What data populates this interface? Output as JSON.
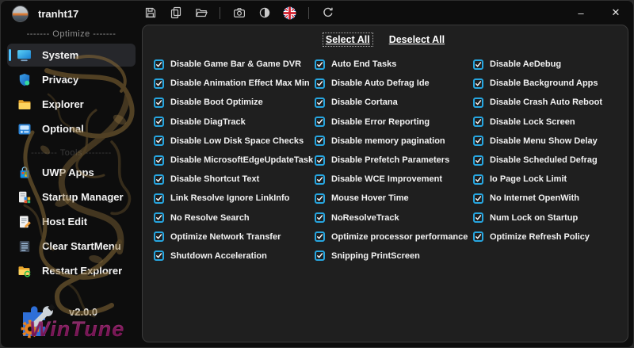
{
  "window": {
    "user": "tranht17",
    "controls": {
      "minimize": "–",
      "close": "✕"
    }
  },
  "toolbar": {
    "icons": [
      "save-icon",
      "copy-icon",
      "open-folder-icon",
      "screenshot-icon",
      "theme-toggle-icon",
      "language-flag-icon-uk",
      "refresh-icon"
    ]
  },
  "sidebar": {
    "sections": [
      {
        "label": "------- Optimize -------",
        "items": [
          {
            "label": "System",
            "icon": "monitor-icon",
            "selected": true
          },
          {
            "label": "Privacy",
            "icon": "shield-icon",
            "selected": false
          },
          {
            "label": "Explorer",
            "icon": "folder-icon",
            "selected": false
          },
          {
            "label": "Optional",
            "icon": "panel-icon",
            "selected": false
          }
        ]
      },
      {
        "label": "-------- Tools --------",
        "items": [
          {
            "label": "UWP Apps",
            "icon": "store-bag-icon",
            "selected": false
          },
          {
            "label": "Startup Manager",
            "icon": "startup-grid-icon",
            "selected": false
          },
          {
            "label": "Host Edit",
            "icon": "document-edit-icon",
            "selected": false
          },
          {
            "label": "Clear StartMenu",
            "icon": "list-icon",
            "selected": false
          },
          {
            "label": "Restart Explorer",
            "icon": "folder-refresh-icon",
            "selected": false
          }
        ]
      }
    ],
    "version": "v2.0.0",
    "brand": "WinTune"
  },
  "main": {
    "select_all": "Select All",
    "deselect_all": "Deselect All",
    "all_checked": true,
    "columns": [
      [
        "Disable Game Bar & Game DVR",
        "Disable Animation Effect Max Min",
        "Disable Boot Optimize",
        "Disable DiagTrack",
        "Disable Low Disk Space Checks",
        "Disable MicrosoftEdgeUpdateTask",
        "Disable Shortcut Text",
        "Link Resolve Ignore LinkInfo",
        "No Resolve Search",
        "Optimize Network Transfer",
        "Shutdown Acceleration"
      ],
      [
        "Auto End Tasks",
        "Disable Auto Defrag Ide",
        "Disable Cortana",
        "Disable Error Reporting",
        "Disable memory pagination",
        "Disable Prefetch Parameters",
        "Disable WCE Improvement",
        "Mouse Hover Time",
        "NoResolveTrack",
        "Optimize processor performance",
        "Snipping PrintScreen"
      ],
      [
        "Disable AeDebug",
        "Disable Background Apps",
        "Disable Crash Auto Reboot",
        "Disable Lock Screen",
        "Disable Menu Show Delay",
        "Disable Scheduled Defrag",
        "Io Page Lock Limit",
        "No Internet OpenWith",
        "Num Lock on Startup",
        "Optimize Refresh Policy"
      ]
    ]
  },
  "colors": {
    "accent": "#4cc2ff",
    "checkbox": "#27a6e0",
    "panel_bg": "#1f1f1f",
    "window_bg": "#0d0d0d",
    "brand_magenta": "#d4318f"
  }
}
